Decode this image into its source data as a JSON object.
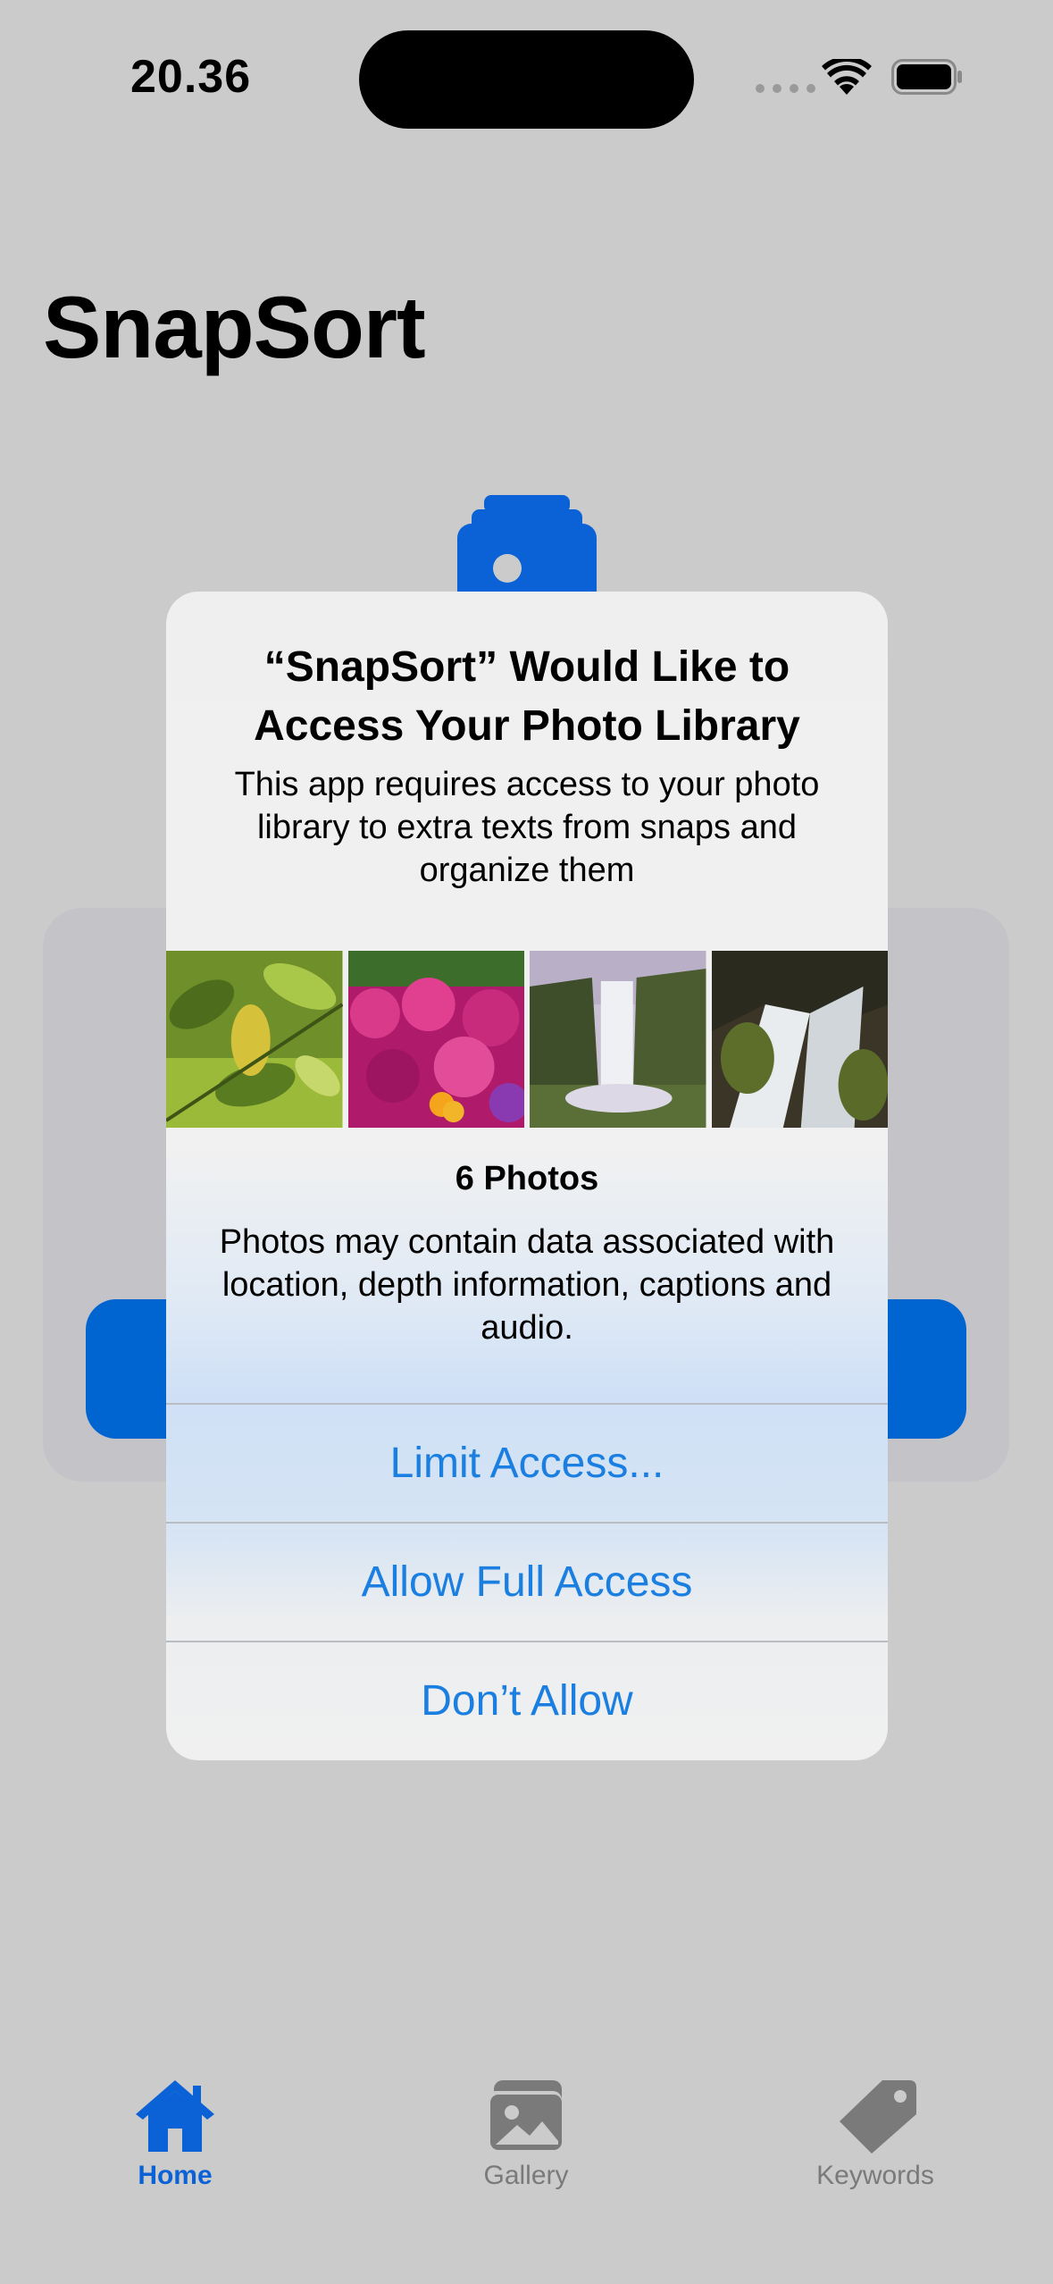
{
  "status_bar": {
    "time": "20.36",
    "icons": [
      "cellular-icon",
      "wifi-icon",
      "battery-icon"
    ]
  },
  "app": {
    "title": "SnapSort"
  },
  "alert": {
    "title": "“SnapSort” Would Like to Access Your Photo Library",
    "message": "This app requires access to your photo library to extra texts from snaps and organize them",
    "photo_count": "6 Photos",
    "note": "Photos may contain data associated with location, depth information, captions and audio.",
    "buttons": {
      "limit": "Limit Access...",
      "full": "Allow Full Access",
      "deny": "Don’t Allow"
    },
    "button_color": "#1A7FE0"
  },
  "tab_bar": {
    "items": [
      {
        "label": "Home",
        "icon": "house-icon",
        "selected": true
      },
      {
        "label": "Gallery",
        "icon": "photo-stack-icon",
        "selected": false
      },
      {
        "label": "Keywords",
        "icon": "tag-icon",
        "selected": false
      }
    ],
    "accent": "#0B62D6"
  }
}
